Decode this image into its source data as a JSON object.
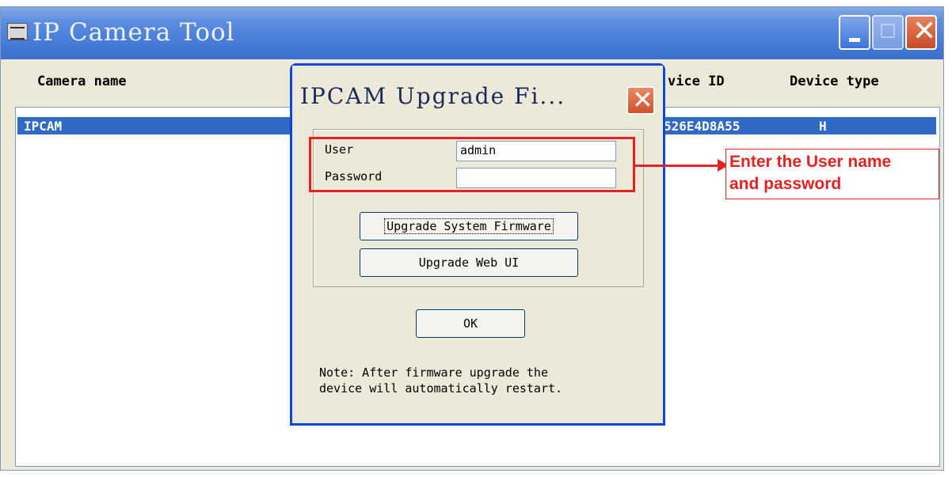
{
  "window": {
    "title": "IP Camera Tool",
    "icon": "ip-camera-tool-icon",
    "buttons": {
      "minimize": "minimize-icon",
      "maximize": "maximize-icon",
      "close": "close-icon"
    }
  },
  "table": {
    "columns": [
      "Camera name",
      "vice ID",
      "Device type"
    ],
    "rows": [
      {
        "camera_name": "IPCAM",
        "device_id": "526E4D8A55",
        "device_type": "H",
        "selected": true
      }
    ]
  },
  "dialog": {
    "title": "IPCAM Upgrade Fi...",
    "user_label": "User",
    "user_value": "admin",
    "password_label": "Password",
    "password_value": "",
    "upgrade_firmware_label": "Upgrade System Firmware",
    "upgrade_webui_label": "Upgrade Web UI",
    "ok_label": "OK",
    "note_line1": "Note: After firmware upgrade the",
    "note_line2": "device will automatically restart."
  },
  "annotation": {
    "line1": "Enter the User name",
    "line2": "and password",
    "color": "#e52222"
  },
  "colors": {
    "titlebar": "#4a7fdb",
    "selection": "#316ac5",
    "window_bg": "#ece9d8"
  }
}
